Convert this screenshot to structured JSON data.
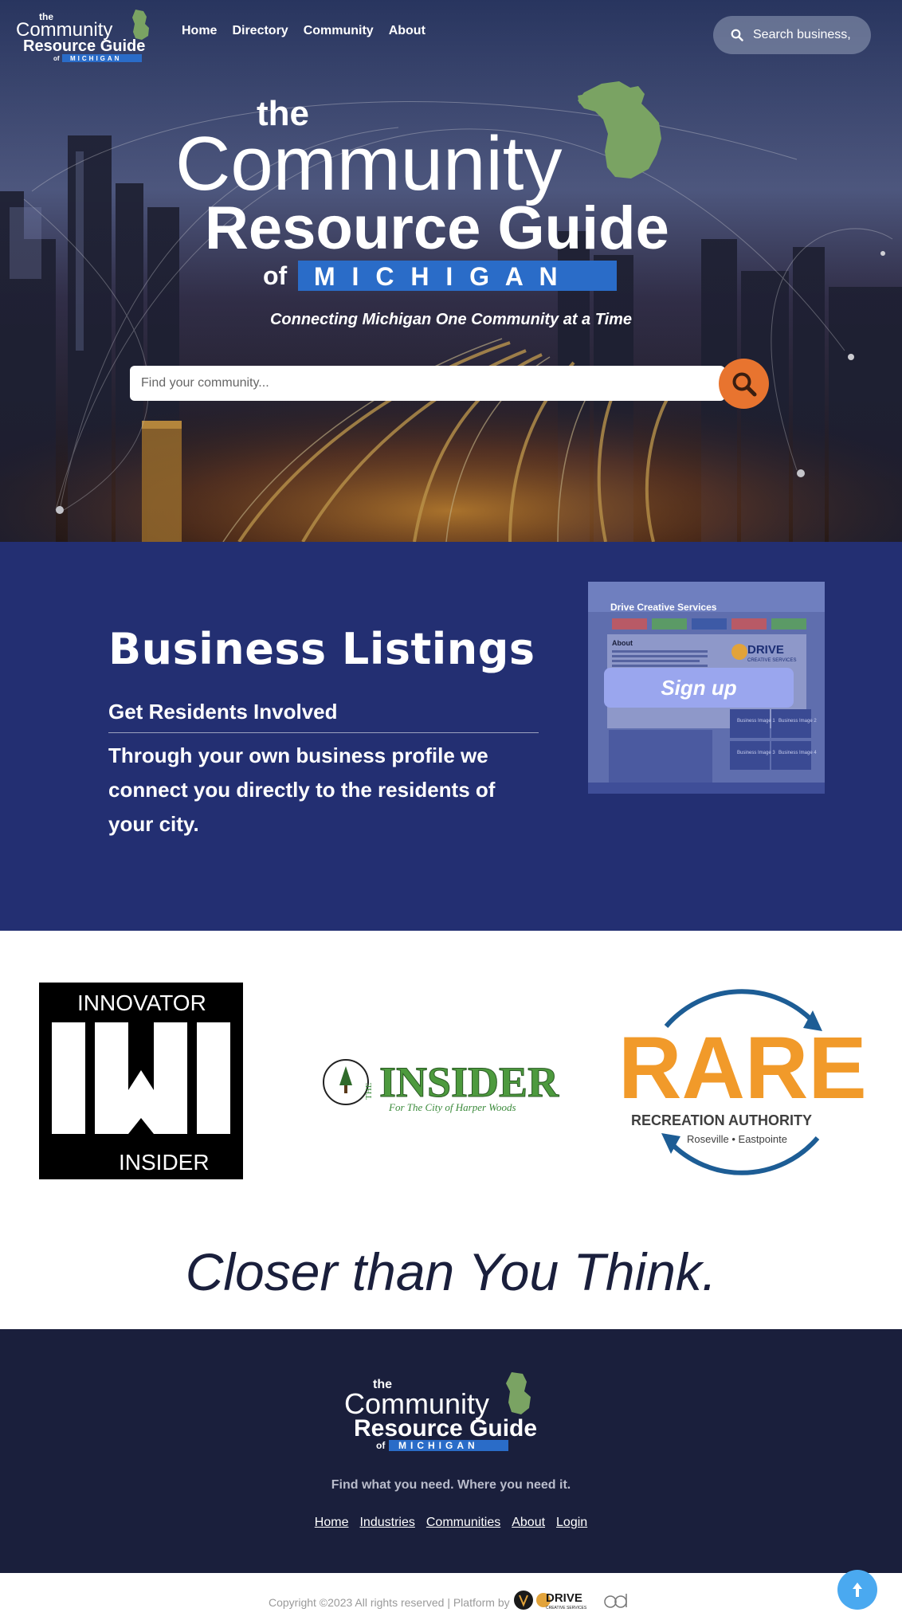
{
  "nav": {
    "logo": {
      "the": "the",
      "community": "Community",
      "resource_guide": "Resource Guide",
      "of": "of",
      "michigan": "MICHIGAN"
    },
    "links": [
      "Home",
      "Directory",
      "Community",
      "About"
    ],
    "search_text": "Search business,",
    "search_icon": "search-icon"
  },
  "hero": {
    "logo": {
      "the": "the",
      "community": "Community",
      "resource_guide": "Resource Guide",
      "of": "of",
      "michigan": "M I C H I G A N"
    },
    "tagline": "Connecting Michigan One Community at a Time",
    "search_placeholder": "Find your community...",
    "search_button_icon": "search-icon"
  },
  "listings": {
    "title": "Business Listings",
    "subtitle": "Get Residents Involved",
    "description": "Through your own business profile we connect you directly to the residents of your city.",
    "signup_label": "Sign up",
    "preview": {
      "business_name": "Drive Creative Services",
      "about_heading": "About",
      "brand": "DRIVE",
      "brand_sub": "CREATIVE SERVICES",
      "images": [
        "Business Image 1",
        "Business Image 2",
        "Business Image 3",
        "Business Image 4"
      ]
    }
  },
  "partners": {
    "innovator": {
      "top": "INNOVATOR",
      "bottom": "INSIDER"
    },
    "insider": {
      "title": "INSIDER",
      "the": "THE",
      "sub": "For The City of Harper Woods"
    },
    "rare": {
      "title": "RARE",
      "sub": "RECREATION AUTHORITY",
      "cities": "Roseville • Eastpointe"
    }
  },
  "closer_text": "Closer than You Think.",
  "footer": {
    "logo": {
      "the": "the",
      "community": "Community",
      "resource_guide": "Resource Guide",
      "of": "of",
      "michigan": "MICHIGAN"
    },
    "tagline": "Find what you need. Where you need it.",
    "links": [
      "Home",
      "Industries",
      "Communities",
      "About",
      "Login"
    ]
  },
  "copyright": "Copyright ©2023 All rights reserved | Platform by",
  "platform": {
    "drive": "DRIVE",
    "drive_sub": "CREATIVE SERVICES"
  },
  "back_to_top_icon": "arrow-up-icon",
  "colors": {
    "navy": "#232f72",
    "footer_navy": "#1a1f3c",
    "orange": "#e8742f",
    "michigan_green": "#7aa363",
    "michigan_blue": "#2a6cc8",
    "signup_blue": "#9aa6ee",
    "back_to_top": "#4aa9f0"
  }
}
